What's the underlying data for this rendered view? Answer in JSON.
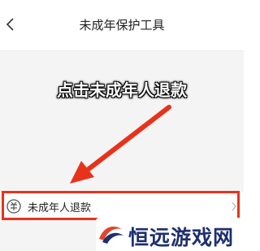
{
  "header": {
    "title": "未成年保护工具"
  },
  "annotation": {
    "callout_text": "点击未成年人退款",
    "arrow_color": "#e8321b",
    "highlight_color": "#e8321b"
  },
  "menu": {
    "item": {
      "label": "未成年人退款",
      "icon": "refund-icon"
    }
  },
  "watermark": {
    "text": "恒远游戏网",
    "text_color": "#1d2f6f"
  }
}
